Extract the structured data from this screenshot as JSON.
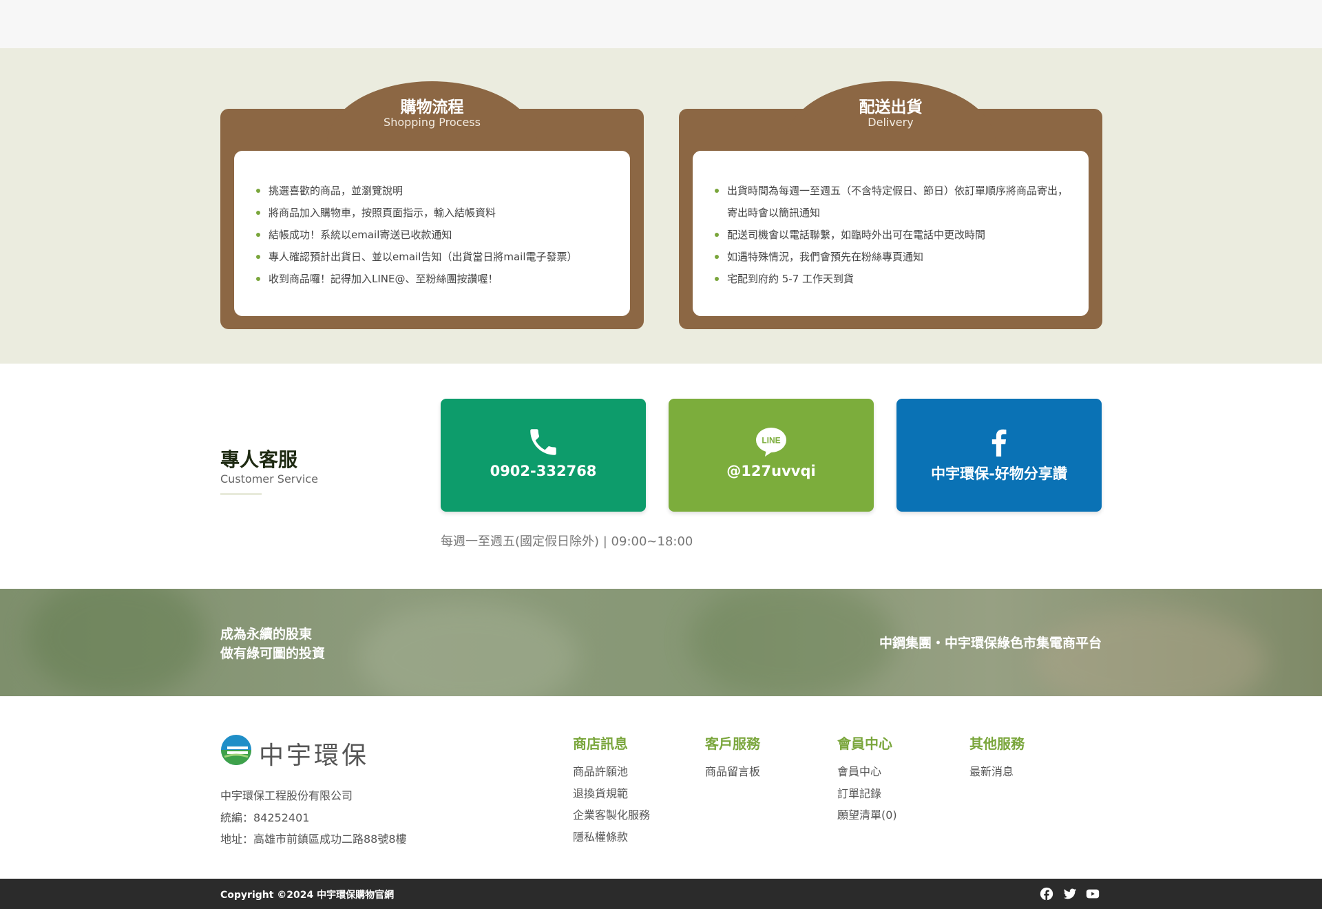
{
  "shopping": {
    "title": "購物流程",
    "subtitle": "Shopping Process",
    "items": [
      "挑選喜歡的商品，並瀏覽說明",
      "將商品加入購物車，按照頁面指示，輸入結帳資料",
      "結帳成功！系統以email寄送已收款通知",
      "專人確認預計出貨日、並以email告知（出貨當日將mail電子發票）",
      "收到商品囉！記得加入LINE@、至粉絲團按讚喔！"
    ]
  },
  "delivery": {
    "title": "配送出貨",
    "subtitle": "Delivery",
    "items": [
      "出貨時間為每週一至週五（不含特定假日、節日）依訂單順序將商品寄出，寄出時會以簡訊通知",
      "配送司機會以電話聯繫，如臨時外出可在電話中更改時間",
      "如遇特殊情況，我們會預先在粉絲專頁通知",
      "宅配到府約 5-7 工作天到貨"
    ]
  },
  "customer_service": {
    "title": "專人客服",
    "subtitle": "Customer Service",
    "phone": "0902-332768",
    "line": "@127uvvqi",
    "facebook": "中宇環保-好物分享讚",
    "hours": "每週一至週五(國定假日除外) | 09:00~18:00"
  },
  "banner": {
    "slogan_line1": "成為永續的股東",
    "slogan_line2": "做有綠可圖的投資",
    "tagline": "中鋼集團・中宇環保綠色市集電商平台"
  },
  "footer": {
    "logo_text": "中宇環保",
    "company_name": "中宇環保工程股份有限公司",
    "tax_id": "統編：84252401",
    "address": "地址：高雄市前鎮區成功二路88號8樓",
    "columns": [
      {
        "title": "商店訊息",
        "links": [
          "商品許願池",
          "退換貨規範",
          "企業客製化服務",
          "隱私權條款"
        ]
      },
      {
        "title": "客戶服務",
        "links": [
          "商品留言板"
        ]
      },
      {
        "title": "會員中心",
        "links": [
          "會員中心",
          "訂單記錄",
          "願望清單(0)"
        ]
      },
      {
        "title": "其他服務",
        "links": [
          "最新消息"
        ]
      }
    ],
    "copyright": "Copyright ©2024 中宇環保購物官網"
  },
  "icons": {
    "phone": "phone-icon",
    "line": "line-icon",
    "facebook": "facebook-icon",
    "twitter": "twitter-icon",
    "youtube": "youtube-icon"
  },
  "colors": {
    "card_brown": "#8c6744",
    "green_accent": "#7aa63c",
    "phone_green": "#0d9c6b",
    "line_green": "#7cad3c",
    "facebook_blue": "#0a72b5"
  }
}
